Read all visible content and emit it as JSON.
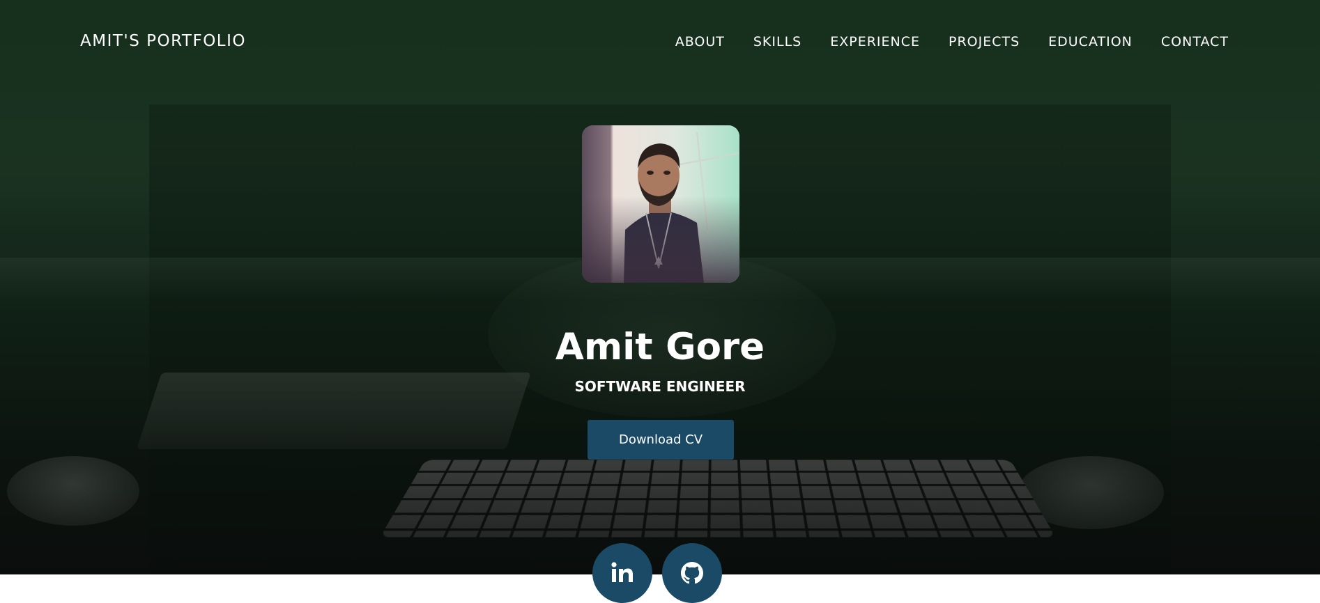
{
  "header": {
    "brand": "AMIT'S PORTFOLIO",
    "nav": [
      "ABOUT",
      "SKILLS",
      "EXPERIENCE",
      "PROJECTS",
      "EDUCATION",
      "CONTACT"
    ]
  },
  "hero": {
    "name": "Amit Gore",
    "role": "SOFTWARE ENGINEER",
    "cv_button": "Download CV",
    "social": [
      {
        "icon": "linkedin-icon",
        "label": "in"
      },
      {
        "icon": "github-icon"
      }
    ]
  },
  "colors": {
    "accent": "#1a4a66",
    "hero_bg": "#16301d",
    "text": "#ffffff"
  }
}
